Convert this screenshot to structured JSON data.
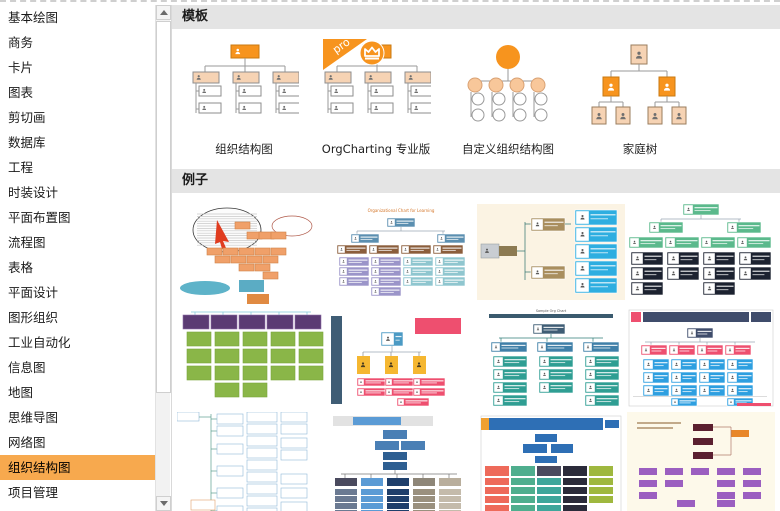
{
  "sidebar": {
    "items": [
      {
        "label": "基本绘图",
        "selected": false
      },
      {
        "label": "商务",
        "selected": false
      },
      {
        "label": "卡片",
        "selected": false
      },
      {
        "label": "图表",
        "selected": false
      },
      {
        "label": "剪切画",
        "selected": false
      },
      {
        "label": "数据库",
        "selected": false
      },
      {
        "label": "工程",
        "selected": false
      },
      {
        "label": "时装设计",
        "selected": false
      },
      {
        "label": "平面布置图",
        "selected": false
      },
      {
        "label": "流程图",
        "selected": false
      },
      {
        "label": "表格",
        "selected": false
      },
      {
        "label": "平面设计",
        "selected": false
      },
      {
        "label": "图形组织",
        "selected": false
      },
      {
        "label": "工业自动化",
        "selected": false
      },
      {
        "label": "信息图",
        "selected": false
      },
      {
        "label": "地图",
        "selected": false
      },
      {
        "label": "思维导图",
        "selected": false
      },
      {
        "label": "网络图",
        "selected": false
      },
      {
        "label": "组织结构图",
        "selected": true
      },
      {
        "label": "项目管理",
        "selected": false
      }
    ],
    "scrollbar": {
      "up_arrow": "scroll-up-arrow",
      "down_arrow": "scroll-down-arrow"
    }
  },
  "main": {
    "templates_section": {
      "title": "模板",
      "cards": [
        {
          "label": "组织结构图",
          "thumb": "orgchart-boxes",
          "pro": false
        },
        {
          "label": "OrgCharting 专业版",
          "thumb": "orgchart-boxes",
          "pro": true,
          "pro_badge_text": "pro",
          "pro_icon": "crown-icon"
        },
        {
          "label": "自定义组织结构图",
          "thumb": "orgchart-circles",
          "pro": false
        },
        {
          "label": "家庭树",
          "thumb": "family-tree",
          "pro": false
        }
      ]
    },
    "examples_section": {
      "title": "例子",
      "items": [
        {
          "name": "example-brainstorm-orange",
          "style": "orange-mindmap"
        },
        {
          "name": "example-org-chart-learning",
          "title": "Organizational Chart for Learning",
          "style": "blue-brown-purple"
        },
        {
          "name": "example-photo-org-chart",
          "style": "cream-teal-blue"
        },
        {
          "name": "example-green-dark-org",
          "style": "green-dark"
        },
        {
          "name": "example-purple-green-matrix",
          "style": "purple-green"
        },
        {
          "name": "example-yellow-pink-chart",
          "style": "navy-yellow-pink"
        },
        {
          "name": "example-world-map-teal",
          "style": "teal-map"
        },
        {
          "name": "example-pink-blue-presentation",
          "style": "pink-blue"
        },
        {
          "name": "example-light-blue-tree",
          "style": "light-blue-vertical"
        },
        {
          "name": "example-dark-blue-hierarchy",
          "style": "dark-blue"
        },
        {
          "name": "example-multicolor-doc-chart",
          "style": "multicolor-doc"
        },
        {
          "name": "example-purple-flow",
          "style": "purple-flow"
        }
      ]
    }
  },
  "colors": {
    "accent_orange": "#f7941e",
    "selected_orange": "#f7a94e",
    "section_header_bg": "#e4e4e4",
    "border_gray": "#d9d9d9",
    "node_peach": "#f6d3b4",
    "node_white": "#ffffff"
  }
}
